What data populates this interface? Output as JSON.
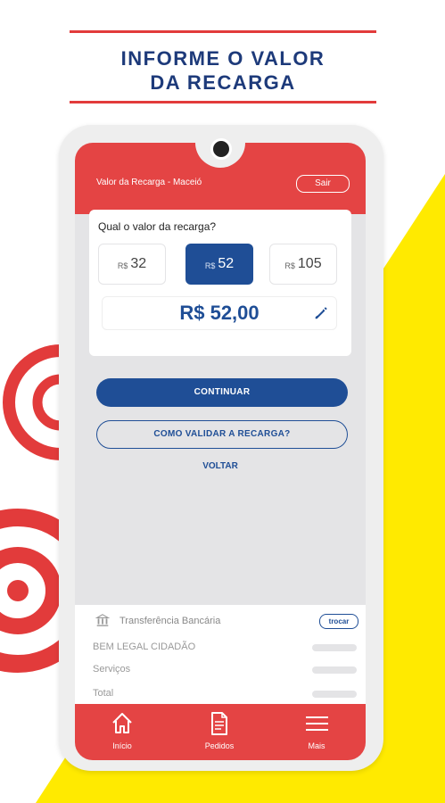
{
  "promo": {
    "title_line1": "INFORME O VALOR",
    "title_line2": "DA RECARGA"
  },
  "colors": {
    "brand_red": "#e44444",
    "brand_blue": "#1f4e96",
    "accent_yellow": "#ffea00"
  },
  "header": {
    "title": "Valor da Recarga - Maceió",
    "exit_label": "Sair"
  },
  "recharge": {
    "question": "Qual o valor da recarga?",
    "options": [
      {
        "currency": "R$",
        "amount": "32",
        "selected": false
      },
      {
        "currency": "R$",
        "amount": "52",
        "selected": true
      },
      {
        "currency": "R$",
        "amount": "105",
        "selected": false
      }
    ],
    "amount_display": "R$ 52,00",
    "edit_icon": "pencil-icon"
  },
  "actions": {
    "continue_label": "CONTINUAR",
    "validate_label": "COMO VALIDAR A RECARGA?",
    "back_label": "VOLTAR"
  },
  "summary": {
    "payment_icon": "bank-transfer-icon",
    "payment_method": "Transferência Bancária",
    "change_label": "trocar",
    "rows": [
      "BEM LEGAL CIDADÃO",
      "Serviços",
      "Total"
    ]
  },
  "nav": {
    "items": [
      {
        "label": "Início",
        "icon": "home-icon"
      },
      {
        "label": "Pedidos",
        "icon": "document-icon"
      },
      {
        "label": "Mais",
        "icon": "menu-icon"
      }
    ]
  }
}
